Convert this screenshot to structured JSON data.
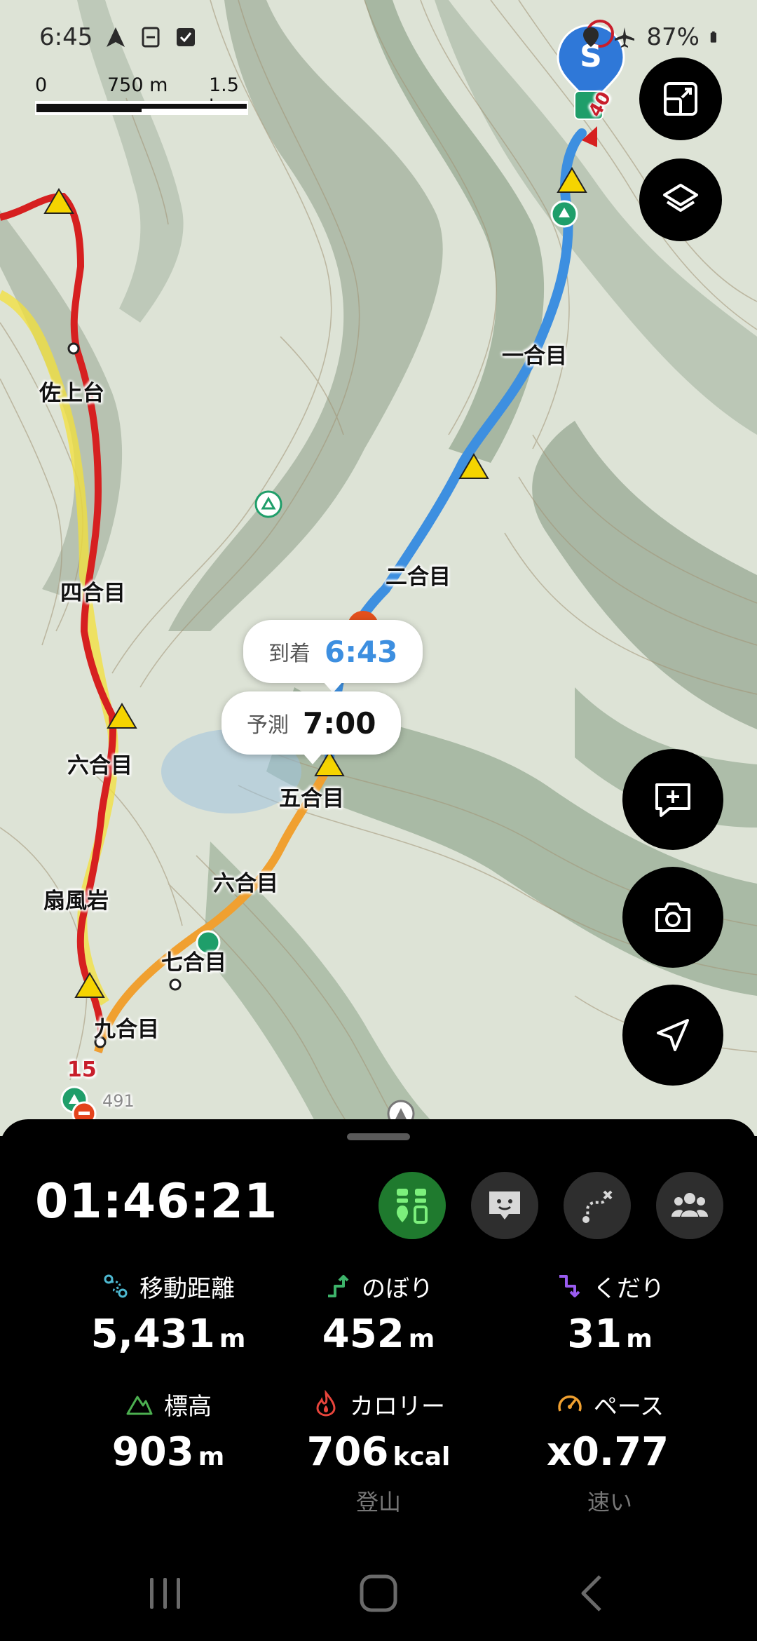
{
  "status_bar": {
    "time": "6:45",
    "battery": "87%",
    "left_icons": [
      "navigation-arrow-icon",
      "sync-icon",
      "checkbox-icon"
    ],
    "right_icons": [
      "location-pin-icon",
      "airplane-mode-icon",
      "battery-icon"
    ]
  },
  "map": {
    "scale": {
      "zero": "0",
      "mid": "750 m",
      "end": "1.5 km"
    },
    "places": {
      "sajodai": "佐上台",
      "yongome_left": "四合目",
      "rokugome_left": "六合目",
      "senpuiwa": "扇風岩",
      "kyugome": "九合目",
      "ichigome": "一合目",
      "nigome": "二合目",
      "gogome": "五合目",
      "rokugome_right": "六合目",
      "nanagome": "七合目"
    },
    "route_markers": {
      "top": "40",
      "bottom": "15"
    },
    "contour_label": "491",
    "arrival": {
      "label": "到着",
      "time": "6:43"
    },
    "forecast": {
      "label": "予測",
      "time": "7:00"
    },
    "colors": {
      "route_blue": "#3d8fe0",
      "route_red": "#d62020",
      "route_orange": "#f0a030",
      "trail_yellow": "#f3e03a"
    }
  },
  "buttons": {
    "expand": "expand-icon",
    "layers": "layers-icon",
    "add_memo": "add-memo-icon",
    "camera": "camera-icon",
    "navigate": "navigation-icon"
  },
  "sheet": {
    "elapsed": "01:46:21",
    "modes": [
      "hiking-mode-icon",
      "chat-icon",
      "route-icon",
      "group-icon"
    ],
    "stats": {
      "distance": {
        "label": "移動距離",
        "value": "5,431",
        "unit": "m"
      },
      "ascent": {
        "label": "のぼり",
        "value": "452",
        "unit": "m"
      },
      "descent": {
        "label": "くだり",
        "value": "31",
        "unit": "m"
      },
      "altitude": {
        "label": "標高",
        "value": "903",
        "unit": "m"
      },
      "calories": {
        "label": "カロリー",
        "value": "706",
        "unit": "kcal",
        "sub": "登山"
      },
      "pace": {
        "label": "ペース",
        "value": "x0.77",
        "unit": "",
        "sub": "速い"
      }
    },
    "accent_colors": {
      "distance": "#4db8d0",
      "ascent": "#3db36a",
      "descent": "#9a5cf0",
      "altitude": "#4caf50",
      "calories": "#e8453c",
      "pace": "#f0a030",
      "active_mode": "#1f7a2e"
    }
  },
  "nav_bar": {
    "icons": [
      "recent-apps-icon",
      "home-icon",
      "back-icon"
    ]
  }
}
